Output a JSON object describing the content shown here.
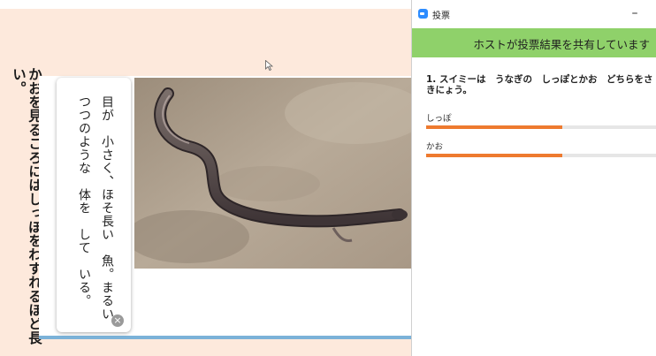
{
  "slide": {
    "vertical_caption": "かおを見るころにはしっぽをわすれるほど長い。",
    "note_text": "目が　小さく、ほそ長い　魚。まるい\nつつのような　体を　して　いる。",
    "note_close_glyph": "×"
  },
  "poll": {
    "window_title": "投票",
    "minimize_glyph": "–",
    "banner_text": "ホストが投票結果を共有しています",
    "banner_color": "#8fd16a",
    "question": "1. スイミーは　うなぎの　しっぽとかお　どちらをさきにょう。",
    "answers": [
      {
        "label": "しっぽ",
        "share": 0.59
      },
      {
        "label": "かお",
        "share": 0.59
      }
    ],
    "bar_color": "#ee7a2f"
  },
  "icons": {
    "poll_app": "zoom-poll-icon",
    "cursor": "mouse-pointer-icon",
    "close": "close-circle-icon"
  }
}
